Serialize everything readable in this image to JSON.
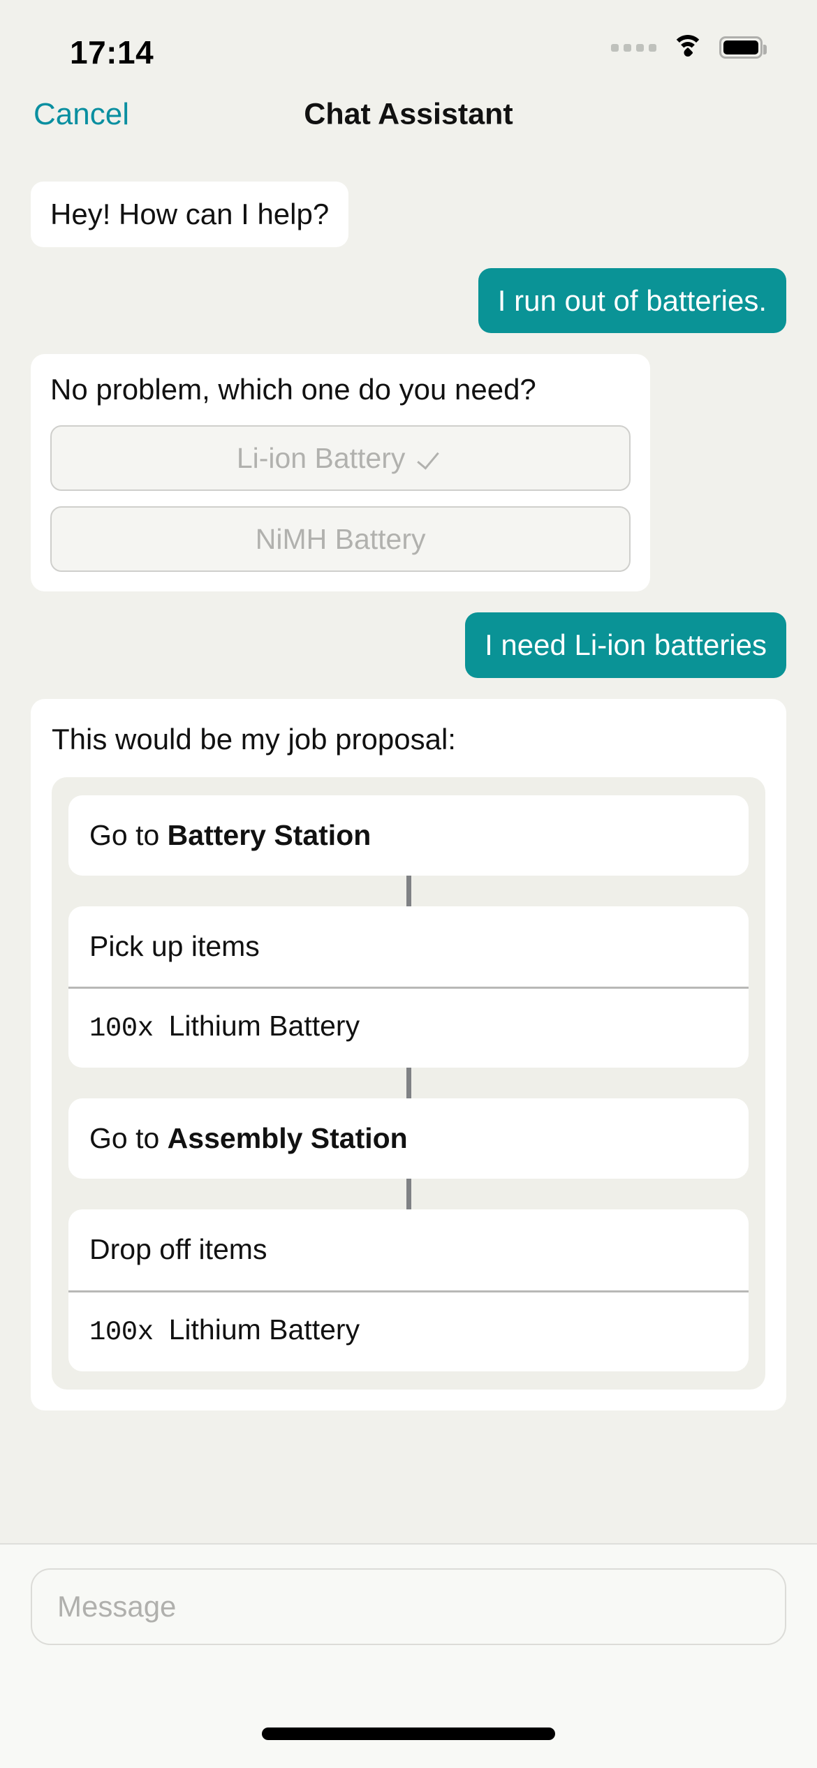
{
  "status_bar": {
    "time": "17:14",
    "signal_icon": "cellular-signal-icon",
    "wifi_icon": "wifi-icon",
    "battery_icon": "battery-full-icon"
  },
  "nav": {
    "cancel_label": "Cancel",
    "title": "Chat Assistant"
  },
  "colors": {
    "accent_teal": "#0A9396",
    "cancel_link": "#0A8FA0",
    "page_background": "#F1F1EC",
    "bubble_bot": "#FFFFFF",
    "step_track": "#EFEFE9",
    "connector": "#7F8184"
  },
  "messages": [
    {
      "id": "m1",
      "sender": "bot",
      "kind": "text",
      "text": "Hey! How can I help?"
    },
    {
      "id": "m2",
      "sender": "user",
      "kind": "text",
      "text": "I run out of batteries."
    },
    {
      "id": "m3",
      "sender": "bot",
      "kind": "options",
      "text": "No problem, which one do you need?",
      "options": [
        {
          "label": "Li-ion Battery",
          "selected": true,
          "check_icon": "check-icon"
        },
        {
          "label": "NiMH Battery",
          "selected": false,
          "check_icon": ""
        }
      ]
    },
    {
      "id": "m4",
      "sender": "user",
      "kind": "text",
      "text": "I need Li-ion batteries"
    },
    {
      "id": "m5",
      "sender": "bot",
      "kind": "job_proposal",
      "text": "This would be my job proposal:",
      "steps": [
        {
          "action_prefix": "Go to ",
          "action_target": "Battery Station",
          "item_qty": "",
          "item_name": ""
        },
        {
          "action_prefix": "Pick up items",
          "action_target": "",
          "item_qty": "100x",
          "item_name": "Lithium Battery"
        },
        {
          "action_prefix": "Go to ",
          "action_target": "Assembly Station",
          "item_qty": "",
          "item_name": ""
        },
        {
          "action_prefix": "Drop off items",
          "action_target": "",
          "item_qty": "100x",
          "item_name": "Lithium Battery"
        }
      ]
    }
  ],
  "composer": {
    "placeholder": "Message",
    "value": ""
  },
  "home_indicator": "home-indicator"
}
